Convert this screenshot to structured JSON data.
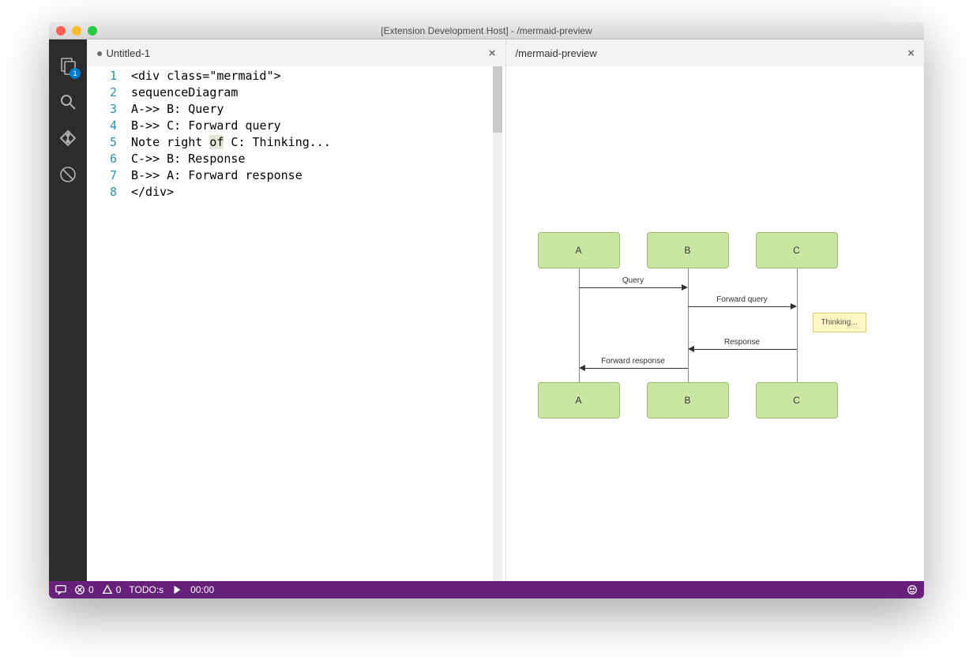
{
  "window": {
    "title": "[Extension Development Host] - /mermaid-preview"
  },
  "activitybar": {
    "explorer_badge": "1"
  },
  "editor_tab": {
    "dirty_indicator": "●",
    "title": "Untitled-1",
    "close": "×"
  },
  "preview_tab": {
    "title": "/mermaid-preview",
    "close": "×"
  },
  "code": {
    "lines": [
      "<div class=\"mermaid\">",
      "sequenceDiagram",
      "A->> B: Query",
      "B->> C: Forward query",
      "Note right of C: Thinking...",
      "C->> B: Response",
      "B->> A: Forward response",
      "</div>"
    ],
    "line_numbers": [
      "1",
      "2",
      "3",
      "4",
      "5",
      "6",
      "7",
      "8"
    ]
  },
  "diagram": {
    "actors": {
      "a": "A",
      "b": "B",
      "c": "C"
    },
    "messages": {
      "q": "Query",
      "fq": "Forward query",
      "r": "Response",
      "fr": "Forward response"
    },
    "note": "Thinking..."
  },
  "statusbar": {
    "errors": "0",
    "warnings": "0",
    "todo": "TODO:s",
    "time": "00:00"
  }
}
